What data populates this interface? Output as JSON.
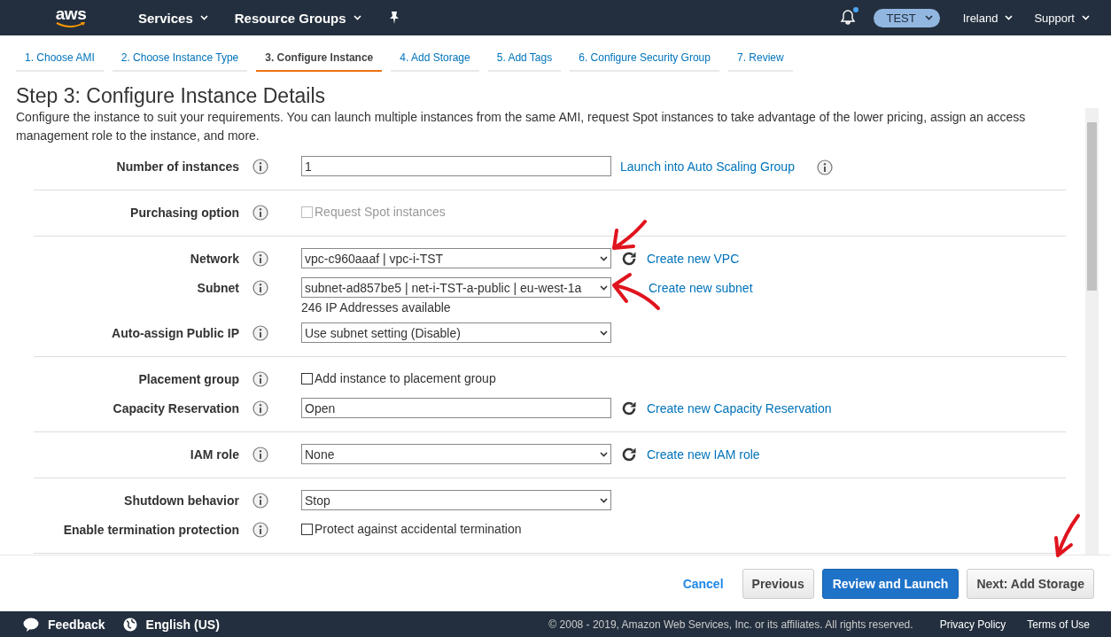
{
  "header": {
    "logo": "aws",
    "menus": [
      {
        "label": "Services"
      },
      {
        "label": "Resource Groups"
      }
    ],
    "account": "TEST",
    "region": "Ireland",
    "support": "Support",
    "notification": true
  },
  "wizard_tabs": [
    {
      "label": "1. Choose AMI",
      "selected": false
    },
    {
      "label": "2. Choose Instance Type",
      "selected": false
    },
    {
      "label": "3. Configure Instance",
      "selected": true
    },
    {
      "label": "4. Add Storage",
      "selected": false
    },
    {
      "label": "5. Add Tags",
      "selected": false
    },
    {
      "label": "6. Configure Security Group",
      "selected": false
    },
    {
      "label": "7. Review",
      "selected": false
    }
  ],
  "title": "Step 3: Configure Instance Details",
  "description": "Configure the instance to suit your requirements. You can launch multiple instances from the same AMI, request Spot instances to take advantage of the lower pricing, assign an access management role to the instance, and more.",
  "sections": [
    {
      "rows": [
        {
          "label": "Number of instances",
          "kind": "input",
          "value": "1",
          "link": "Launch into Auto Scaling Group",
          "link_info": true
        }
      ]
    },
    {
      "rows": [
        {
          "label": "Purchasing option",
          "kind": "checkbox",
          "text": "Request Spot instances",
          "checked": false,
          "disabled": true
        }
      ]
    },
    {
      "rows": [
        {
          "label": "Network",
          "kind": "select",
          "value": "vpc-c960aaaf | vpc-i-TST",
          "refresh": true,
          "link": "Create new VPC"
        },
        {
          "label": "Subnet",
          "kind": "select",
          "value": "subnet-ad857be5 | net-i-TST-a-public | eu-west-1a",
          "refresh": false,
          "link": "Create new subnet",
          "note": "246 IP Addresses available"
        },
        {
          "label": "Auto-assign Public IP",
          "kind": "select",
          "value": "Use subnet setting (Disable)"
        }
      ]
    },
    {
      "rows": [
        {
          "label": "Placement group",
          "kind": "checkbox",
          "text": "Add instance to placement group",
          "checked": false,
          "disabled": false
        },
        {
          "label": "Capacity Reservation",
          "kind": "input",
          "value": "Open",
          "refresh": true,
          "link": "Create new Capacity Reservation"
        }
      ]
    },
    {
      "rows": [
        {
          "label": "IAM role",
          "kind": "select",
          "value": "None",
          "refresh": true,
          "link": "Create new IAM role"
        }
      ]
    },
    {
      "rows": [
        {
          "label": "Shutdown behavior",
          "kind": "select",
          "value": "Stop"
        },
        {
          "label": "Enable termination protection",
          "kind": "checkbox",
          "text": "Protect against accidental termination",
          "checked": false,
          "disabled": false
        }
      ]
    }
  ],
  "actions": {
    "cancel": "Cancel",
    "previous": "Previous",
    "primary": "Review and Launch",
    "next": "Next: Add Storage"
  },
  "footer": {
    "feedback": "Feedback",
    "language": "English (US)",
    "copyright": "© 2008 - 2019, Amazon Web Services, Inc. or its affiliates. All rights reserved.",
    "links": [
      "Privacy Policy",
      "Terms of Use"
    ]
  }
}
